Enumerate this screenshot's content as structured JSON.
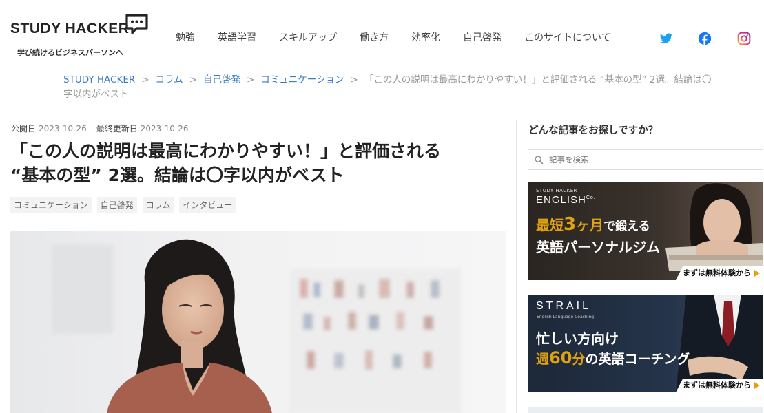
{
  "header": {
    "logo_text": "STUDY HACKER",
    "tagline": "学び続けるビジネスパーソンへ",
    "nav": [
      "勉強",
      "英語学習",
      "スキルアップ",
      "働き方",
      "効率化",
      "自己啓発",
      "このサイトについて"
    ],
    "social": [
      "twitter-icon",
      "facebook-icon",
      "instagram-icon"
    ]
  },
  "breadcrumb": {
    "items": [
      "STUDY HACKER",
      "コラム",
      "自己啓発",
      "コミュニケーション"
    ],
    "separator": ">",
    "current": "「この人の説明は最高にわかりやすい！」と評価される “基本の型” 2選。結論は〇字以内がベスト"
  },
  "article": {
    "published_label": "公開日",
    "published_date": "2023-10-26",
    "updated_label": "最終更新日",
    "updated_date": "2023-10-26",
    "title_line1": "「この人の説明は最高にわかりやすい！」と評価される",
    "title_line2": "“基本の型” 2選。結論は〇字以内がベスト",
    "tags": [
      "コミュニケーション",
      "自己啓発",
      "コラム",
      "インタビュー"
    ]
  },
  "sidebar": {
    "search_heading": "どんな記事をお探しですか？",
    "search_placeholder": "記事を検索",
    "banner1": {
      "brand_small": "STUDY HACKER",
      "brand": "ENGLISH",
      "brand_co": "Co.",
      "line1_pre": "最短",
      "line1_num": "3",
      "line1_unit": "ヶ月",
      "line1_post": "で鍛える",
      "line2": "英語パーソナルジム",
      "cta": "まずは無料体験から"
    },
    "banner2": {
      "brand": "STRAIL",
      "brand_sub": "English Language Coaching",
      "line1": "忙しい方向け",
      "line2_pre": "週",
      "line2_num": "60",
      "line2_unit": "分",
      "line2_post": "の英語コーチング",
      "cta": "まずは無料体験から"
    }
  },
  "colors": {
    "link": "#3b7bbf",
    "accent_gold": "#e0a210",
    "twitter": "#1da1f2",
    "facebook": "#1877f2"
  }
}
